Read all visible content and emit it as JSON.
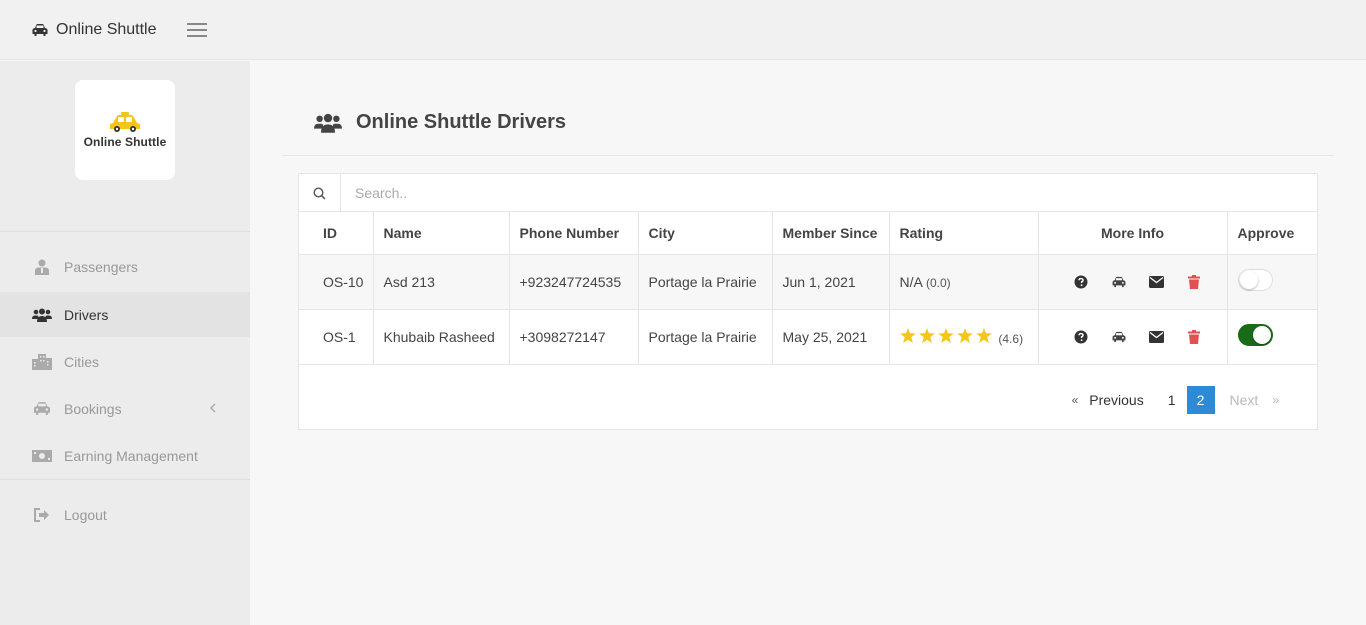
{
  "app": {
    "title": "Online Shuttle",
    "logo_text": "Online Shuttle"
  },
  "sidebar": {
    "items": [
      {
        "label": "Passengers",
        "icon": "user-icon"
      },
      {
        "label": "Drivers",
        "icon": "users-icon",
        "active": true
      },
      {
        "label": "Cities",
        "icon": "city-icon"
      },
      {
        "label": "Bookings",
        "icon": "car-icon"
      },
      {
        "label": "Earning Management",
        "icon": "money-icon"
      }
    ],
    "logout": {
      "label": "Logout",
      "icon": "logout-icon"
    }
  },
  "page": {
    "title": "Online Shuttle Drivers"
  },
  "search": {
    "placeholder": "Search.."
  },
  "table": {
    "columns": [
      "ID",
      "Name",
      "Phone Number",
      "City",
      "Member Since",
      "Rating",
      "More Info",
      "Approve"
    ],
    "rows": [
      {
        "id": "OS-10",
        "name": "Asd 213",
        "phone": "+923247724535",
        "city": "Portage la Prairie",
        "member_since": "Jun 1, 2021",
        "rating_text": "N/A",
        "rating_value": "(0.0)",
        "stars": 0,
        "approved": false
      },
      {
        "id": "OS-1",
        "name": "Khubaib Rasheed",
        "phone": "+3098272147",
        "city": "Portage la Prairie",
        "member_since": "May 25, 2021",
        "rating_text": "",
        "rating_value": "(4.6)",
        "stars": 5,
        "approved": true
      }
    ]
  },
  "pagination": {
    "prev_arrow": "«",
    "previous": "Previous",
    "pages": [
      "1",
      "2"
    ],
    "current": "2",
    "next": "Next",
    "next_arrow": "»"
  },
  "colors": {
    "accent": "#2d8ad6",
    "star": "#f5c518",
    "toggle_on": "#1a6b17",
    "delete": "#e05252"
  }
}
